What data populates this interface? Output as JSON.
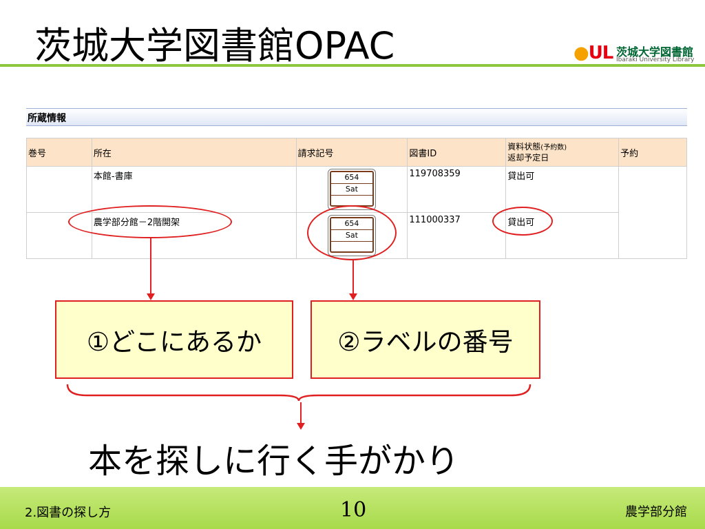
{
  "slide": {
    "title": "茨城大学図書館OPAC",
    "logo": {
      "mark": "UL",
      "name_jp": "茨城大学図書館",
      "name_en": "Ibaraki University Library"
    }
  },
  "holdings": {
    "section_title": "所蔵情報",
    "columns": {
      "volume": "巻号",
      "location": "所在",
      "call_number": "請求記号",
      "book_id": "図書ID",
      "status": "資料状態",
      "status_sub": "(予約数)",
      "due_date": "返却予定日",
      "reserve": "予約"
    },
    "rows": [
      {
        "volume": "",
        "location": "本館-書庫",
        "label_line1": "654",
        "label_line2": "Sat",
        "book_id": "119708359",
        "status": "貸出可"
      },
      {
        "volume": "",
        "location": "農学部分館－2階開架",
        "label_line1": "654",
        "label_line2": "Sat",
        "book_id": "111000337",
        "status": "貸出可"
      }
    ]
  },
  "callouts": {
    "where": "①どこにあるか",
    "label_number": "②ラベルの番号",
    "conclusion": "本を探しに行く手がかり"
  },
  "footer": {
    "section": "2.図書の探し方",
    "page": "10",
    "branch": "農学部分館"
  },
  "colors": {
    "accent_red": "#e02020",
    "title_rule_green": "#8dc63f",
    "table_header": "#fde4c8",
    "callout_fill": "#ffffcc"
  }
}
